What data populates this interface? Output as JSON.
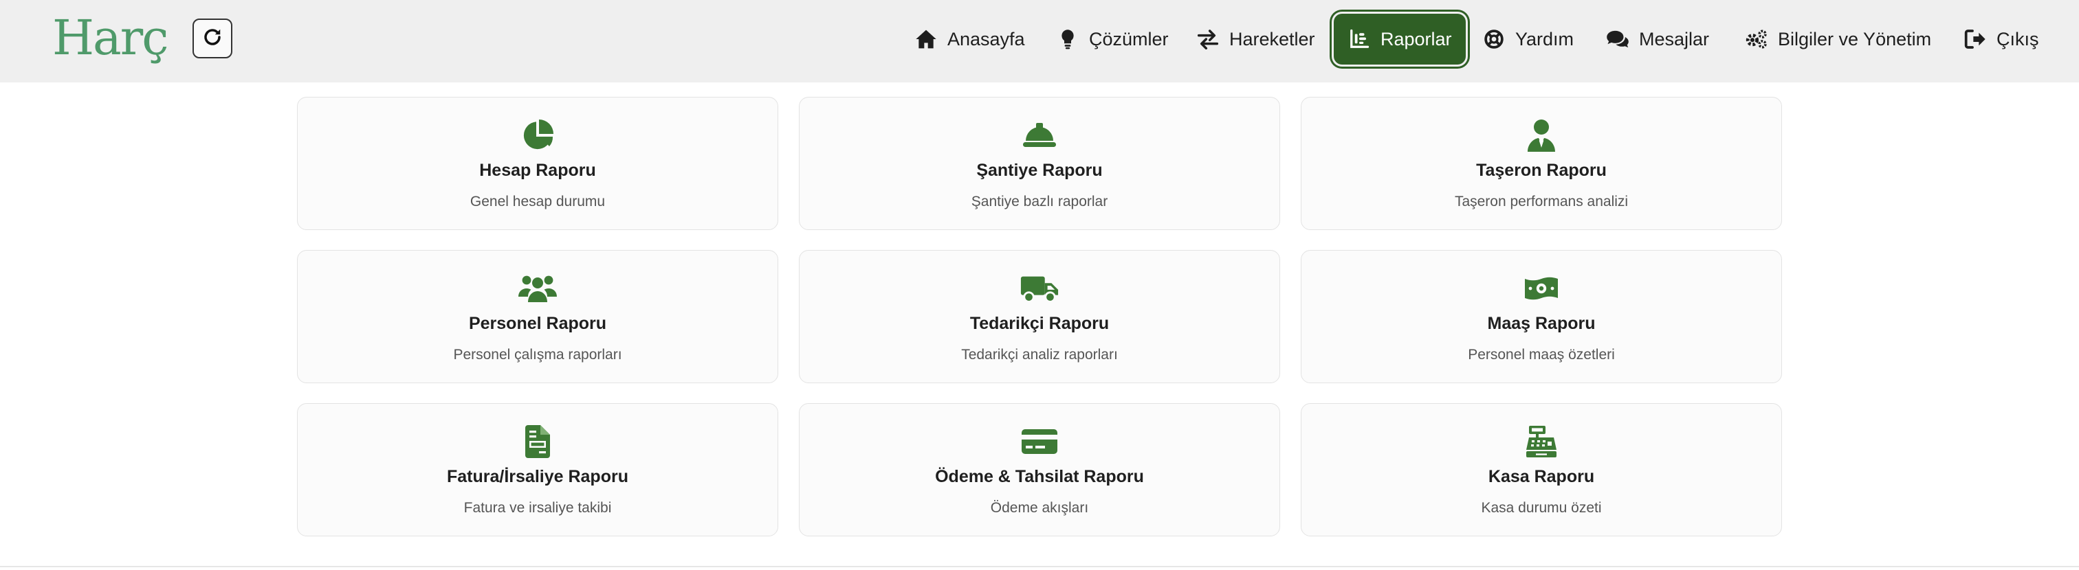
{
  "brand": {
    "logo_text": "Harç"
  },
  "nav": {
    "items": [
      {
        "label": "Anasayfa",
        "icon": "home-icon"
      },
      {
        "label": "Çözümler",
        "icon": "lightbulb-icon"
      },
      {
        "label": "Hareketler",
        "icon": "arrows-exchange-icon"
      },
      {
        "label": "Raporlar",
        "icon": "chart-icon",
        "active": true
      },
      {
        "label": "Yardım",
        "icon": "lifebuoy-icon"
      },
      {
        "label": "Mesajlar",
        "icon": "comments-icon"
      },
      {
        "label": "Bilgiler ve Yönetim",
        "icon": "gears-icon"
      },
      {
        "label": "Çıkış",
        "icon": "sign-out-icon"
      }
    ]
  },
  "cards": [
    {
      "title": "Hesap Raporu",
      "desc": "Genel hesap durumu",
      "icon": "pie-chart-icon"
    },
    {
      "title": "Şantiye Raporu",
      "desc": "Şantiye bazlı raporlar",
      "icon": "hard-hat-icon"
    },
    {
      "title": "Taşeron Raporu",
      "desc": "Taşeron performans analizi",
      "icon": "user-tie-icon"
    },
    {
      "title": "Personel Raporu",
      "desc": "Personel çalışma raporları",
      "icon": "users-icon"
    },
    {
      "title": "Tedarikçi Raporu",
      "desc": "Tedarikçi analiz raporları",
      "icon": "truck-icon"
    },
    {
      "title": "Maaş Raporu",
      "desc": "Personel maaş özetleri",
      "icon": "money-bill-icon"
    },
    {
      "title": "Fatura/İrsaliye Raporu",
      "desc": "Fatura ve irsaliye takibi",
      "icon": "invoice-icon"
    },
    {
      "title": "Ödeme & Tahsilat Raporu",
      "desc": "Ödeme akışları",
      "icon": "credit-card-icon"
    },
    {
      "title": "Kasa Raporu",
      "desc": "Kasa durumu özeti",
      "icon": "cash-register-icon"
    }
  ],
  "colors": {
    "accent": "#2f5f25",
    "icon_green": "#3d7a35",
    "logo": "#4f9a6a"
  }
}
